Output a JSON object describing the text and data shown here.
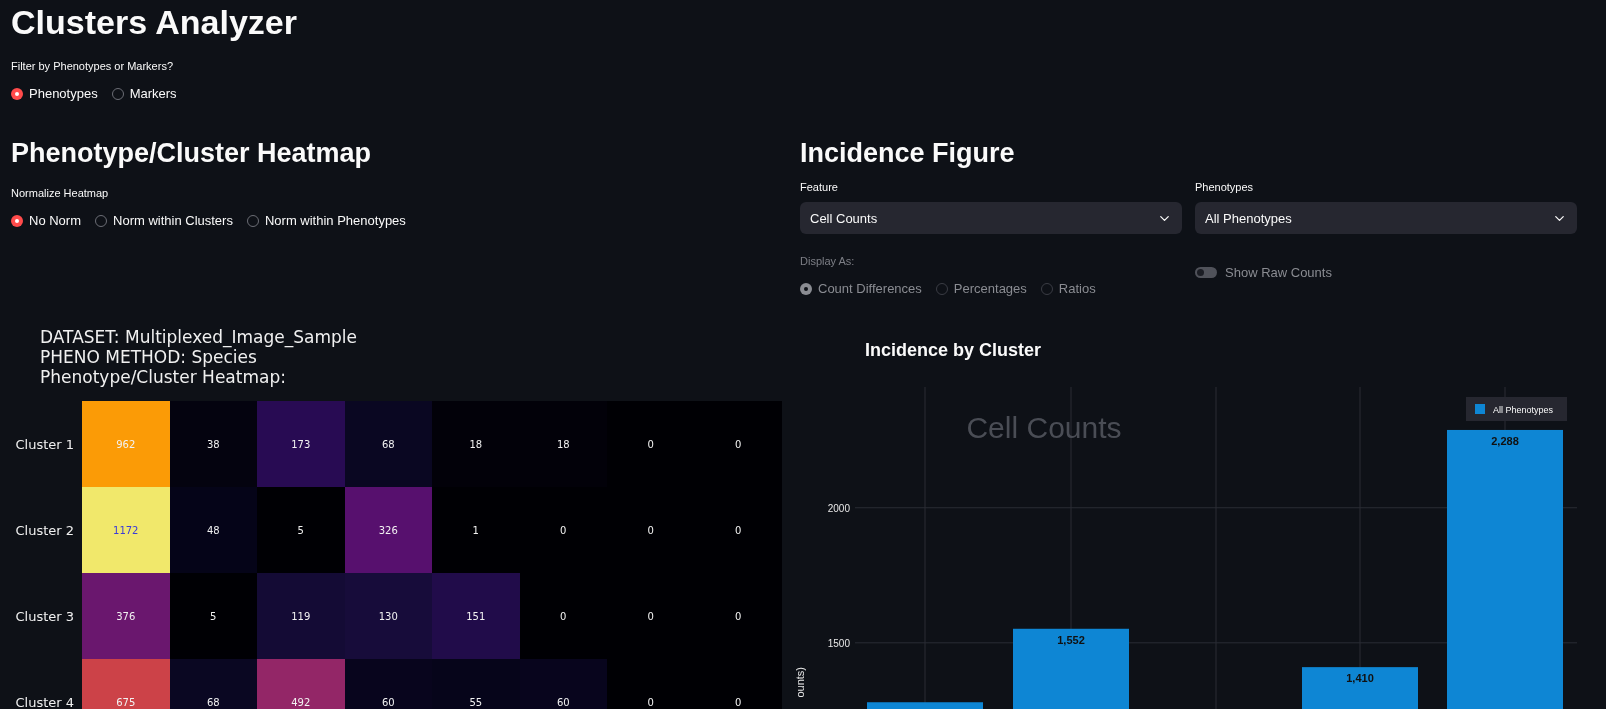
{
  "title": "Clusters Analyzer",
  "filter": {
    "label": "Filter by Phenotypes or Markers?",
    "options": [
      {
        "label": "Phenotypes",
        "selected": true
      },
      {
        "label": "Markers",
        "selected": false
      }
    ]
  },
  "heatmap_section": {
    "heading": "Phenotype/Cluster Heatmap",
    "normalize": {
      "label": "Normalize Heatmap",
      "options": [
        {
          "label": "No Norm",
          "selected": true
        },
        {
          "label": "Norm within Clusters",
          "selected": false
        },
        {
          "label": "Norm within Phenotypes",
          "selected": false
        }
      ]
    },
    "figure": {
      "title_lines": [
        "DATASET: Multiplexed_Image_Sample",
        "PHENO METHOD: Species",
        "Phenotype/Cluster Heatmap:"
      ],
      "rows": [
        {
          "label": "Cluster 1",
          "cells": [
            {
              "value": "962",
              "color": "#fb9b06"
            },
            {
              "value": "38",
              "color": "#04030f"
            },
            {
              "value": "173",
              "color": "#280b53"
            },
            {
              "value": "68",
              "color": "#0a0722"
            },
            {
              "value": "18",
              "color": "#020109"
            },
            {
              "value": "18",
              "color": "#020109"
            },
            {
              "value": "0",
              "color": "#000004"
            },
            {
              "value": "0",
              "color": "#000004"
            }
          ]
        },
        {
          "label": "Cluster 2",
          "cells": [
            {
              "value": "1172",
              "color": "#f1e86b"
            },
            {
              "value": "48",
              "color": "#050418"
            },
            {
              "value": "5",
              "color": "#000004"
            },
            {
              "value": "326",
              "color": "#57106e"
            },
            {
              "value": "1",
              "color": "#000004"
            },
            {
              "value": "0",
              "color": "#000004"
            },
            {
              "value": "0",
              "color": "#000004"
            },
            {
              "value": "0",
              "color": "#000004"
            }
          ]
        },
        {
          "label": "Cluster 3",
          "cells": [
            {
              "value": "376",
              "color": "#6a176e"
            },
            {
              "value": "5",
              "color": "#000004"
            },
            {
              "value": "119",
              "color": "#140b35"
            },
            {
              "value": "130",
              "color": "#170c3a"
            },
            {
              "value": "151",
              "color": "#210c4a"
            },
            {
              "value": "0",
              "color": "#000004"
            },
            {
              "value": "0",
              "color": "#000004"
            },
            {
              "value": "0",
              "color": "#000004"
            }
          ]
        },
        {
          "label": "Cluster 4",
          "cells": [
            {
              "value": "675",
              "color": "#cc4248"
            },
            {
              "value": "68",
              "color": "#0a0722"
            },
            {
              "value": "492",
              "color": "#932667"
            },
            {
              "value": "60",
              "color": "#08051d"
            },
            {
              "value": "55",
              "color": "#06051a"
            },
            {
              "value": "60",
              "color": "#08051d"
            },
            {
              "value": "0",
              "color": "#000004"
            },
            {
              "value": "0",
              "color": "#000004"
            }
          ]
        }
      ]
    }
  },
  "incidence_section": {
    "heading": "Incidence Figure",
    "feature": {
      "label": "Feature",
      "value": "Cell Counts"
    },
    "phenotypes": {
      "label": "Phenotypes",
      "value": "All Phenotypes"
    },
    "display_as": {
      "label": "Display As:",
      "disabled": true,
      "options": [
        {
          "label": "Count Differences",
          "selected": true
        },
        {
          "label": "Percentages",
          "selected": false
        },
        {
          "label": "Ratios",
          "selected": false
        }
      ]
    },
    "raw_counts": {
      "label": "Show Raw Counts",
      "on": false,
      "disabled": true
    },
    "chart": {
      "title": "Incidence by Cluster",
      "chart_data": {
        "type": "bar",
        "grid": true,
        "ylabel": "ounts)",
        "annotations": [
          "Cell Counts"
        ],
        "ylim": [
          1255,
          2410
        ],
        "yticks": [
          1500,
          2000
        ],
        "series": [
          {
            "name": "All Phenotypes",
            "color": "#0e86d4",
            "values": [
              1280,
              1552,
              null,
              1410,
              2288
            ]
          }
        ],
        "value_labels": [
          null,
          "1,552",
          null,
          "1,410",
          "2,288"
        ]
      }
    }
  }
}
